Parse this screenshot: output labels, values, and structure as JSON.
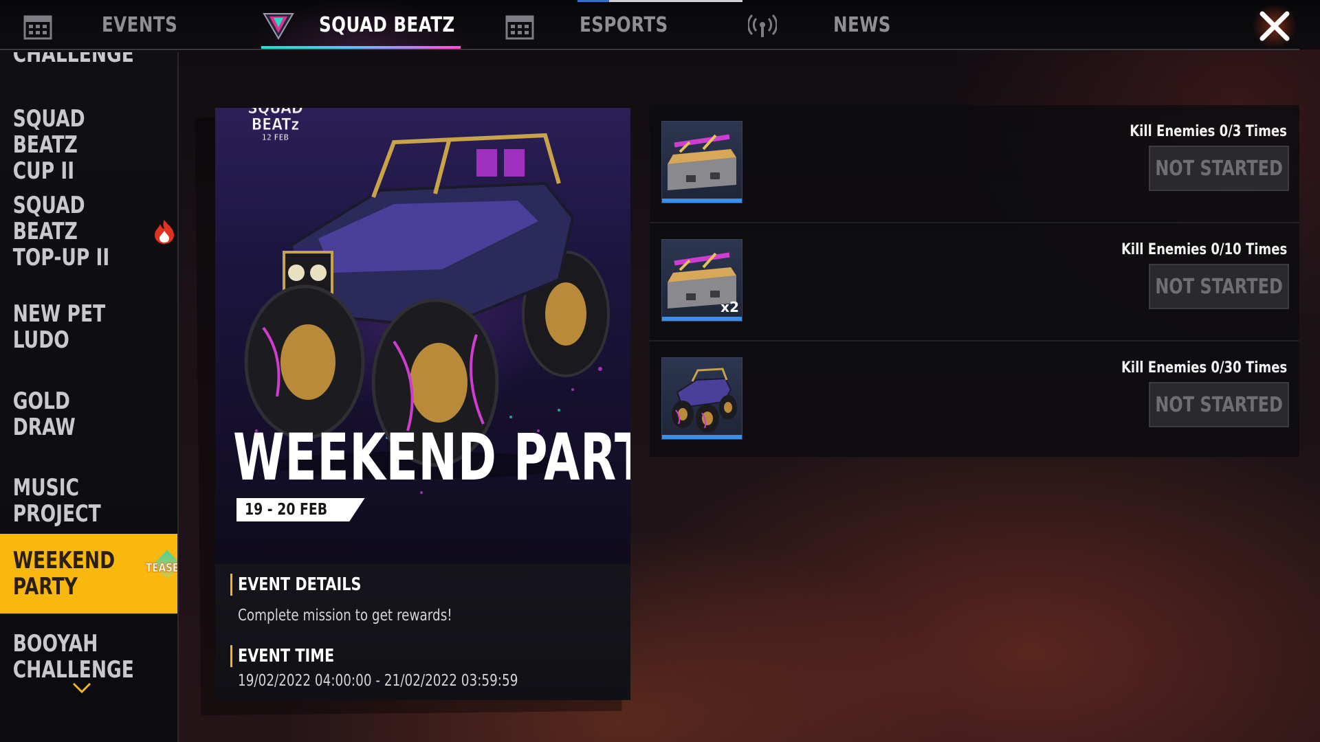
{
  "nav": {
    "tabs": [
      {
        "label": "EVENTS",
        "active": false,
        "icon": "calendar-icon"
      },
      {
        "label": "SQUAD BEATZ",
        "active": true,
        "icon": "squad-beatz-logo-icon"
      },
      {
        "label": "ESPORTS",
        "active": false,
        "icon": "calendar-icon"
      },
      {
        "label": "NEWS",
        "active": false,
        "icon": "broadcast-icon"
      }
    ],
    "close_icon": "close-icon",
    "accent": "#f9b80e"
  },
  "sidebar": {
    "items": [
      {
        "label": "CHALLENGE",
        "active": false
      },
      {
        "label": "SQUAD BEATZ\nCUP II",
        "active": false
      },
      {
        "label": "SQUAD BEATZ\nTOP-UP II",
        "active": false,
        "badge": "flame-icon"
      },
      {
        "label": "NEW PET LUDO",
        "active": false
      },
      {
        "label": "GOLD DRAW",
        "active": false
      },
      {
        "label": "MUSIC\nPROJECT",
        "active": false
      },
      {
        "label": "WEEKEND\nPARTY",
        "active": true,
        "badge_text": "TEASER"
      },
      {
        "label": "BOOYAH\nCHALLENGE",
        "active": false
      }
    ],
    "scroll_icon": "chevron-down-icon"
  },
  "event": {
    "logo_text_line1": "SQUAD",
    "logo_text_line2": "BEATz",
    "logo_date": "12 FEB",
    "title": "WEEKEND PARTY",
    "date_tag": "19 - 20 FEB",
    "details_heading": "EVENT DETAILS",
    "details_text": "Complete mission to get rewards!",
    "time_heading": "EVENT TIME",
    "time_text": "19/02/2022 04:00:00 - 21/02/2022 03:59:59"
  },
  "missions": [
    {
      "label": "Kill Enemies 0/3 Times",
      "status": "NOT STARTED",
      "reward": "weapon-crate-icon",
      "qty": ""
    },
    {
      "label": "Kill Enemies 0/10 Times",
      "status": "NOT STARTED",
      "reward": "weapon-crate-icon",
      "qty": "x2"
    },
    {
      "label": "Kill Enemies 0/30 Times",
      "status": "NOT STARTED",
      "reward": "monster-truck-icon",
      "qty": ""
    }
  ]
}
